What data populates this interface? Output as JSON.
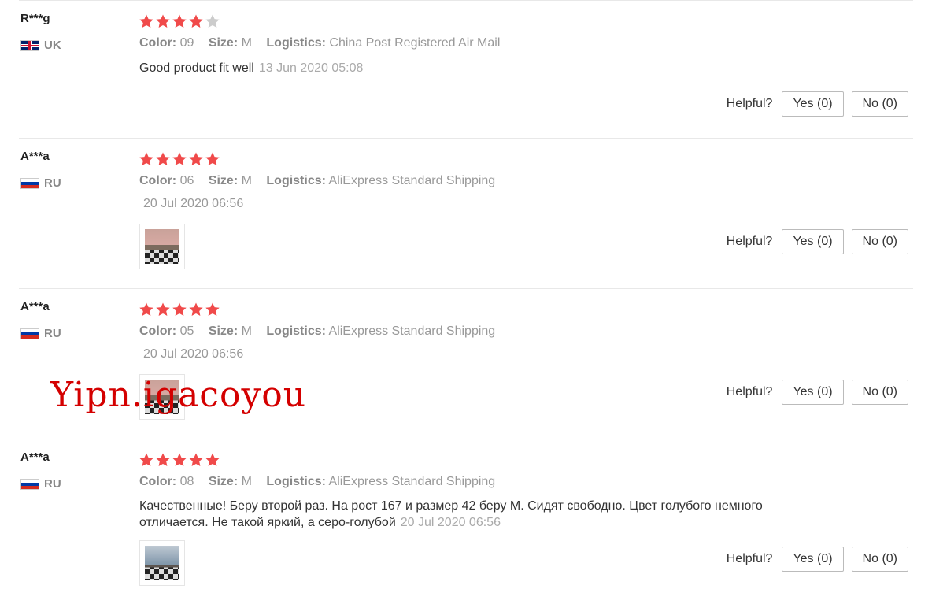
{
  "colors": {
    "star_on": "#f04a4a",
    "star_off": "#cccccc",
    "watermark": "#d40000"
  },
  "helpful_label": "Helpful?",
  "labels": {
    "color": "Color:",
    "size": "Size:",
    "logistics": "Logistics:"
  },
  "reviews": [
    {
      "user": "R***g",
      "country": "UK",
      "flag_icon": "uk-flag-icon",
      "rating": 4,
      "color": "09",
      "size": "M",
      "logistics": "China Post Registered Air Mail",
      "text": "Good product fit well",
      "date": "13 Jun 2020 05:08",
      "yes": "Yes (0)",
      "no": "No (0)"
    },
    {
      "user": "A***a",
      "country": "RU",
      "flag_icon": "russia-flag-icon",
      "rating": 5,
      "color": "06",
      "size": "M",
      "logistics": "AliExpress Standard Shipping",
      "date": "20 Jul 2020 06:56",
      "has_photo": true,
      "yes": "Yes (0)",
      "no": "No (0)"
    },
    {
      "user": "A***a",
      "country": "RU",
      "flag_icon": "russia-flag-icon",
      "rating": 5,
      "color": "05",
      "size": "M",
      "logistics": "AliExpress Standard Shipping",
      "date": "20 Jul 2020 06:56",
      "has_photo": true,
      "yes": "Yes (0)",
      "no": "No (0)"
    },
    {
      "user": "A***a",
      "country": "RU",
      "flag_icon": "russia-flag-icon",
      "rating": 5,
      "color": "08",
      "size": "M",
      "logistics": "AliExpress Standard Shipping",
      "text_line1": "Качественные! Беру второй раз. На рост 167 и размер 42 беру М. Сидят свободно. Цвет голубого немного",
      "text_line2": "отличается. Не такой яркий, а серо-голубой",
      "date": "20 Jul 2020 06:56",
      "has_photo": true,
      "yes": "Yes (0)",
      "no": "No (0)"
    }
  ],
  "watermark": "Yipn.igacoyou"
}
